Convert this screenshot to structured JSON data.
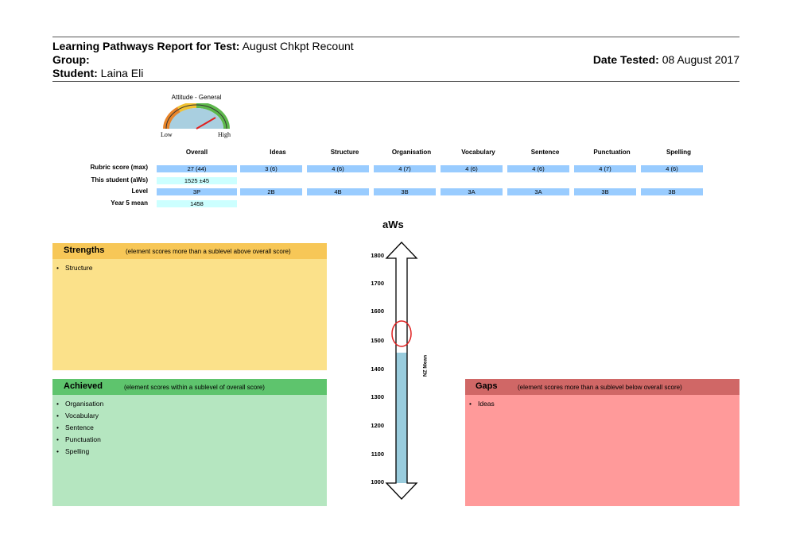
{
  "header": {
    "report_label": "Learning Pathways Report for Test:",
    "test_name": "August Chkpt Recount",
    "group_label": "Group:",
    "group_value": "",
    "student_label": "Student:",
    "student_name": "Laina Eli",
    "date_label": "Date Tested:",
    "date_value": "08 August 2017"
  },
  "gauge": {
    "title": "Attitude - General",
    "low_label": "Low",
    "high_label": "High",
    "level_fraction": 0.82
  },
  "table": {
    "columns": [
      "Overall",
      "Ideas",
      "Structure",
      "Organisation",
      "Vocabulary",
      "Sentence",
      "Punctuation",
      "Spelling"
    ],
    "rows": {
      "rubric": {
        "label": "Rubric score (max)",
        "values": [
          "27 (44)",
          "3 (6)",
          "4 (6)",
          "4 (7)",
          "4 (6)",
          "4 (6)",
          "4 (7)",
          "4 (6)"
        ]
      },
      "student": {
        "label": "This student (aWs)",
        "value": "1525 ±45"
      },
      "level": {
        "label": "Level",
        "values": [
          "3P",
          "2B",
          "4B",
          "3B",
          "3A",
          "3A",
          "3B",
          "3B"
        ]
      },
      "mean": {
        "label": "Year 5 mean",
        "value": "1458"
      }
    }
  },
  "scale": {
    "title": "aWs",
    "ticks": [
      "1800",
      "1700",
      "1600",
      "1500",
      "1400",
      "1300",
      "1200",
      "1100",
      "1000"
    ],
    "nz_mean_label": "NZ Mean",
    "min": 1000,
    "max": 1800,
    "student_score": 1525,
    "nz_mean": 1458
  },
  "strengths": {
    "title": "Strengths",
    "subtitle": "(element scores more than a sublevel above overall score)",
    "items": [
      "Structure"
    ]
  },
  "achieved": {
    "title": "Achieved",
    "subtitle": "(element scores within a sublevel of overall score)",
    "items": [
      "Organisation",
      "Vocabulary",
      "Sentence",
      "Punctuation",
      "Spelling"
    ]
  },
  "gaps": {
    "title": "Gaps",
    "subtitle": "(element scores more than a sublevel below overall score)",
    "items": [
      "Ideas"
    ]
  },
  "colors": {
    "strengths_head": "#f7c757",
    "strengths_body": "#fbe18a",
    "achieved_head": "#5ec46d",
    "achieved_body": "#b5e6c0",
    "gaps_head": "#d06766",
    "gaps_body": "#ff9a9a",
    "scale_fill": "#99ccdd",
    "marker": "#e02020"
  }
}
